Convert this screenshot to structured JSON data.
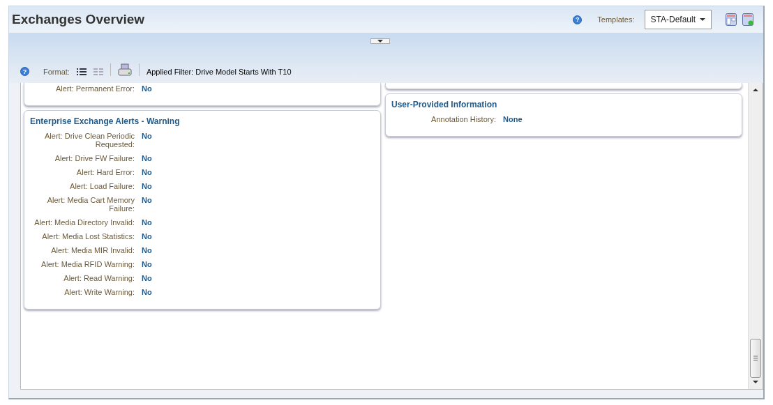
{
  "header": {
    "title": "Exchanges Overview",
    "help": "?",
    "templates_label": "Templates:",
    "template_value": "STA-Default"
  },
  "toolbar": {
    "help": "?",
    "format_label": "Format:",
    "filter_text": "Applied Filter: Drive Model Starts With T10"
  },
  "left_column": [
    {
      "fields": [
        {
          "label": "Alert: Permanent Error:",
          "value": "No"
        }
      ]
    },
    {
      "title": "Enterprise Exchange Alerts - Warning",
      "fields": [
        {
          "label": "Alert: Drive Clean Periodic Requested:",
          "value": "No"
        },
        {
          "label": "Alert: Drive FW Failure:",
          "value": "No"
        },
        {
          "label": "Alert: Hard Error:",
          "value": "No"
        },
        {
          "label": "Alert: Load Failure:",
          "value": "No"
        },
        {
          "label": "Alert: Media Cart Memory Failure:",
          "value": "No"
        },
        {
          "label": "Alert: Media Directory Invalid:",
          "value": "No"
        },
        {
          "label": "Alert: Media Lost Statistics:",
          "value": "No"
        },
        {
          "label": "Alert: Media MIR Invalid:",
          "value": "No"
        },
        {
          "label": "Alert: Media RFID Warning:",
          "value": "No"
        },
        {
          "label": "Alert: Read Warning:",
          "value": "No"
        },
        {
          "label": "Alert: Write Warning:",
          "value": "No"
        }
      ]
    }
  ],
  "right_column": [
    {
      "title": "User-Provided Information",
      "fields": [
        {
          "label": "Annotation History:",
          "value": "None"
        }
      ]
    }
  ]
}
